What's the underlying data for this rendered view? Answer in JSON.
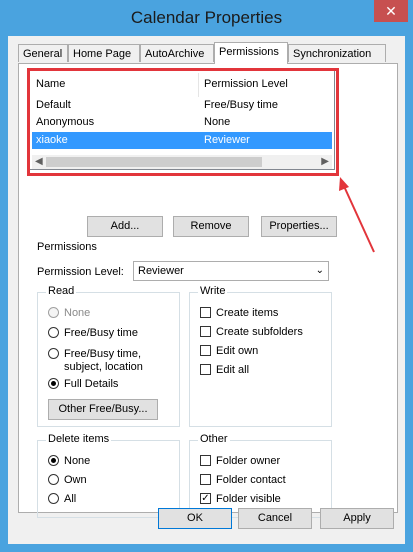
{
  "window": {
    "title": "Calendar Properties",
    "close": "✕"
  },
  "tabs": [
    {
      "label": "General"
    },
    {
      "label": "Home Page"
    },
    {
      "label": "AutoArchive"
    },
    {
      "label": "Permissions"
    },
    {
      "label": "Synchronization"
    }
  ],
  "list": {
    "headers": [
      "Name",
      "Permission Level"
    ],
    "rows": [
      {
        "name": "Default",
        "level": "Free/Busy time"
      },
      {
        "name": "Anonymous",
        "level": "None"
      },
      {
        "name": "xiaoke",
        "level": "Reviewer"
      }
    ],
    "selected_index": 2
  },
  "list_buttons": {
    "add": "Add...",
    "remove": "Remove",
    "properties": "Properties..."
  },
  "permissions": {
    "group_title": "Permissions",
    "level_label": "Permission Level:",
    "level_value": "Reviewer",
    "read": {
      "title": "Read",
      "options": [
        "None",
        "Free/Busy time",
        "Free/Busy time,",
        "subject, location",
        "Full Details"
      ],
      "selected": "Full Details",
      "other_button": "Other Free/Busy..."
    },
    "write": {
      "title": "Write",
      "options": [
        {
          "label": "Create items",
          "checked": false
        },
        {
          "label": "Create subfolders",
          "checked": false
        },
        {
          "label": "Edit own",
          "checked": false
        },
        {
          "label": "Edit all",
          "checked": false
        }
      ]
    },
    "delete": {
      "title": "Delete items",
      "options": [
        "None",
        "Own",
        "All"
      ],
      "selected": "None"
    },
    "other": {
      "title": "Other",
      "options": [
        {
          "label": "Folder owner",
          "checked": false
        },
        {
          "label": "Folder contact",
          "checked": false
        },
        {
          "label": "Folder visible",
          "checked": true
        }
      ]
    }
  },
  "footer": {
    "ok": "OK",
    "cancel": "Cancel",
    "apply": "Apply"
  },
  "colors": {
    "titlebar": "#4aa3df",
    "selection": "#3399ff",
    "highlight": "#e2353b",
    "close": "#c75050"
  }
}
